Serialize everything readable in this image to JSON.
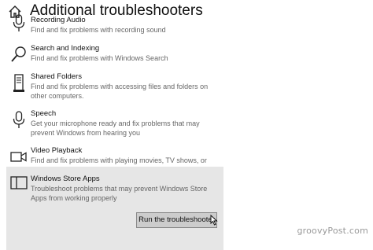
{
  "header": {
    "title": "Additional troubleshooters"
  },
  "items": [
    {
      "title": "Recording Audio",
      "description": "Find and fix problems with recording sound",
      "icon": "microphone-icon"
    },
    {
      "title": "Search and Indexing",
      "description": "Find and fix problems with Windows Search",
      "icon": "search-icon"
    },
    {
      "title": "Shared Folders",
      "description": "Find and fix problems with accessing files and folders on other computers.",
      "icon": "shared-folders-icon"
    },
    {
      "title": "Speech",
      "description": "Get your microphone ready and fix problems that may prevent Windows from hearing you",
      "icon": "microphone-icon"
    },
    {
      "title": "Video Playback",
      "description": "Find and fix problems with playing movies, TV shows, or videos",
      "icon": "video-icon"
    },
    {
      "title": "Windows Store Apps",
      "description": "Troubleshoot problems that may prevent Windows Store Apps from working properly",
      "icon": "store-apps-icon"
    }
  ],
  "run_button": {
    "label": "Run the troubleshooter"
  },
  "watermark": "groovyPost.com"
}
